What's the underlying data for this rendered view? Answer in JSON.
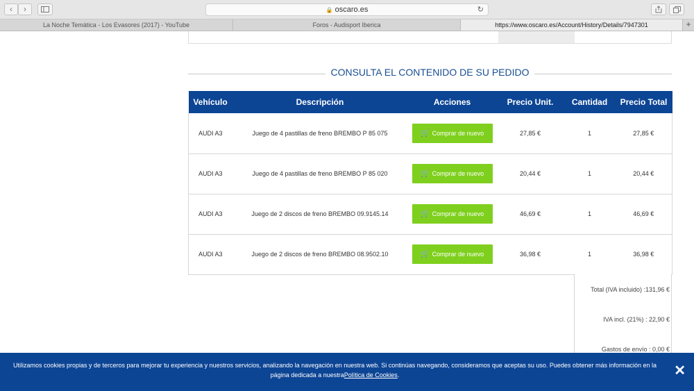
{
  "browser": {
    "url_short": "oscaro.es",
    "tabs": [
      {
        "label": "La Noche Temática - Los Evasores (2017) - YouTube"
      },
      {
        "label": "Foros - Audisport Iberica"
      },
      {
        "label": "https://www.oscaro.es/Account/History/Details/7947301"
      }
    ],
    "new_tab": "+"
  },
  "section": {
    "title": "CONSULTA EL CONTENIDO DE SU PEDIDO"
  },
  "table": {
    "headers": [
      "Vehículo",
      "Descripción",
      "Acciones",
      "Precio Unit.",
      "Cantidad",
      "Precio Total"
    ],
    "buy_label": "Comprar de nuevo",
    "rows": [
      {
        "vehicle": "AUDI A3",
        "description": "Juego de 4 pastillas de freno BREMBO P 85 075",
        "unit_price": "27,85 €",
        "quantity": "1",
        "total": "27,85 €"
      },
      {
        "vehicle": "AUDI A3",
        "description": "Juego de 4 pastillas de freno BREMBO P 85 020",
        "unit_price": "20,44 €",
        "quantity": "1",
        "total": "20,44 €"
      },
      {
        "vehicle": "AUDI A3",
        "description": "Juego de 2 discos de freno BREMBO 09.9145.14",
        "unit_price": "46,69 €",
        "quantity": "1",
        "total": "46,69 €"
      },
      {
        "vehicle": "AUDI A3",
        "description": "Juego de 2 discos de freno BREMBO 08.9502.10",
        "unit_price": "36,98 €",
        "quantity": "1",
        "total": "36,98 €"
      }
    ]
  },
  "totals": {
    "total": "Total (IVA incluido) :131,96 €",
    "iva": "IVA incl. (21%) :  22,90 €",
    "shipping": "Gastos de envío :    0,00 €"
  },
  "cookie": {
    "text1": "Utilizamos cookies propias y de terceros para mejorar tu experiencia y nuestros servicios, analizando la navegación en nuestra web. Si continúas navegando, consideramos que aceptas su uso. Puedes obtener más información en la",
    "text2": "página dedicada a nuestra",
    "link": "Política de Cookies",
    "text3": ".",
    "close": "✕"
  },
  "colors": {
    "brand_blue": "#0d4595",
    "buy_green": "#7fd01e"
  }
}
